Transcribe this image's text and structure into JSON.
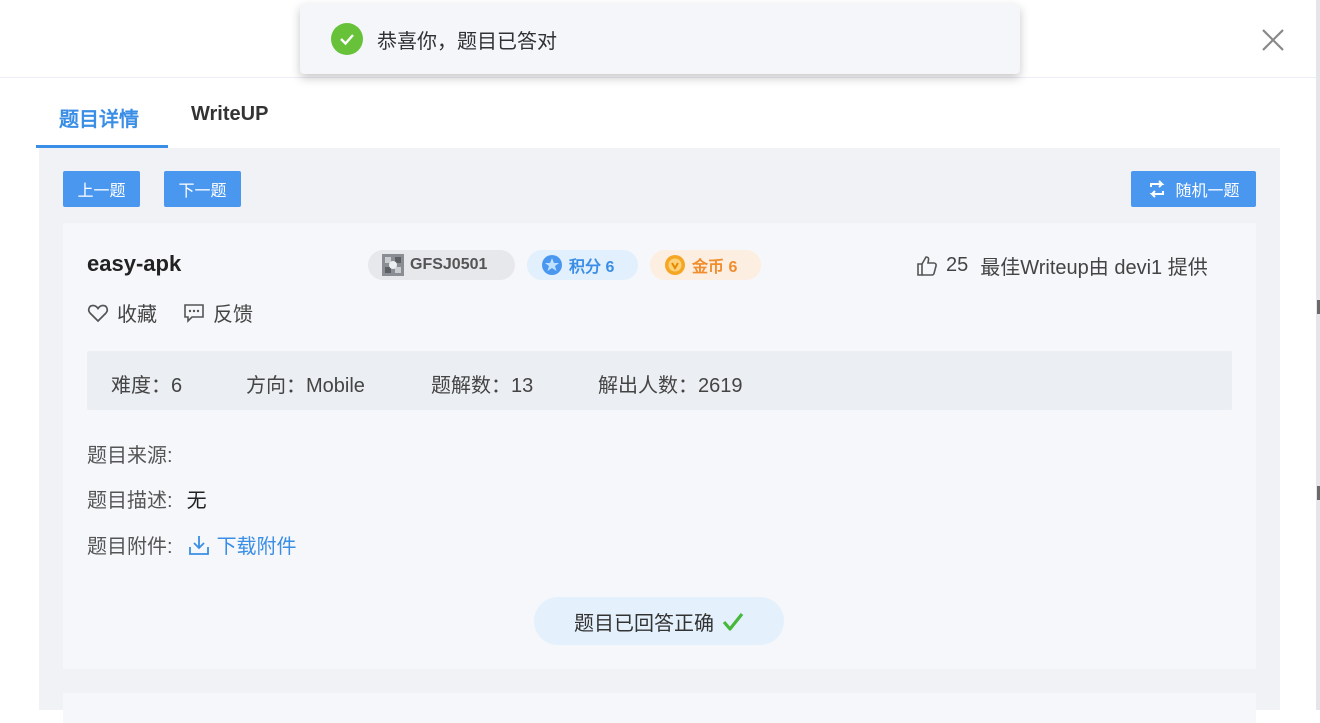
{
  "toast": {
    "message": "恭喜你，题目已答对",
    "icon": "check-circle-icon"
  },
  "tabs": [
    {
      "label": "题目详情",
      "active": true
    },
    {
      "label": "WriteUP",
      "active": false
    }
  ],
  "nav": {
    "prev_label": "上一题",
    "next_label": "下一题",
    "random_label": "随机一题"
  },
  "challenge": {
    "title": "easy-apk",
    "badges": {
      "id": "GFSJ0501",
      "points": "积分 6",
      "coins": "金币 6"
    },
    "likes": "25",
    "best_writeup": "最佳Writeup由 devi1 提供",
    "favorite_label": "收藏",
    "feedback_label": "反馈",
    "stats": {
      "difficulty": "难度：6",
      "direction": "方向：Mobile",
      "writeups": "题解数：13",
      "solvers": "解出人数：2619"
    },
    "source_label": "题目来源:",
    "description_label": "题目描述:",
    "description_value": "无",
    "attachment_label": "题目附件:",
    "download_label": "下载附件",
    "answered_label": "题目已回答正确"
  },
  "colors": {
    "accent": "#3a8ee6",
    "success": "#67c23a",
    "coin": "#f08d2c"
  }
}
